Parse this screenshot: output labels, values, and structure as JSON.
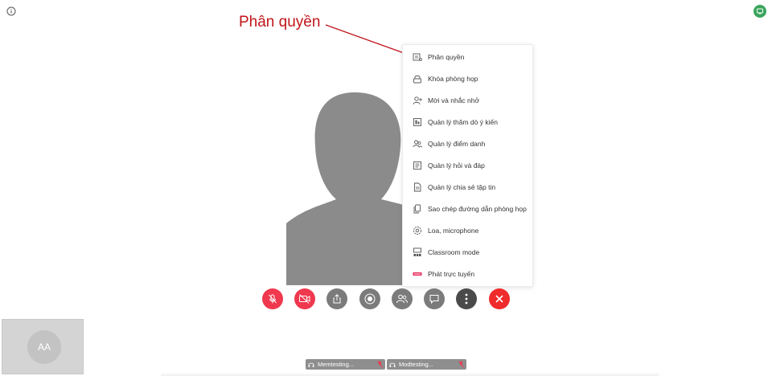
{
  "annotation": {
    "text": "Phân quyền",
    "color": "#c0151b"
  },
  "menu": {
    "items": [
      {
        "label": "Phân quyền",
        "icon": "permission-icon"
      },
      {
        "label": "Khóa phòng họp",
        "icon": "lock-icon"
      },
      {
        "label": "Mời và nhắc nhở",
        "icon": "invite-user-icon"
      },
      {
        "label": "Quản lý thăm dò ý kiến",
        "icon": "poll-icon"
      },
      {
        "label": "Quản lý điểm danh",
        "icon": "attendance-icon"
      },
      {
        "label": "Quản lý hỏi và đáp",
        "icon": "qa-icon"
      },
      {
        "label": "Quản lý chia sẻ tập tin",
        "icon": "file-icon"
      },
      {
        "label": "Sao chép đường dẫn phòng họp",
        "icon": "copy-link-icon"
      },
      {
        "label": "Loa, microphone",
        "icon": "settings-icon"
      },
      {
        "label": "Classroom mode",
        "icon": "classroom-icon"
      },
      {
        "label": "Phát trực tuyến",
        "icon": "live-stream-icon"
      }
    ]
  },
  "controls": [
    {
      "name": "mute-mic-button",
      "icon": "mic-off-icon",
      "color": "#f0384e"
    },
    {
      "name": "camera-off-button",
      "icon": "camera-off-icon",
      "color": "#f0384e"
    },
    {
      "name": "share-button",
      "icon": "share-icon",
      "color": "#7b7b7b"
    },
    {
      "name": "record-button",
      "icon": "record-icon",
      "color": "#7b7b7b"
    },
    {
      "name": "participants-button",
      "icon": "participants-icon",
      "color": "#7b7b7b"
    },
    {
      "name": "chat-button",
      "icon": "chat-icon",
      "color": "#7b7b7b"
    },
    {
      "name": "more-button",
      "icon": "more-vertical-icon",
      "color": "#4a4a4a"
    },
    {
      "name": "leave-button",
      "icon": "close-icon",
      "color": "#ef2b2b"
    }
  ],
  "self_view": {
    "initials": "AA"
  },
  "participants": [
    {
      "name": "Memtesting..."
    },
    {
      "name": "Modtesting..."
    }
  ],
  "colors": {
    "accent_red": "#f0384e",
    "status_green": "#3aa55d"
  }
}
